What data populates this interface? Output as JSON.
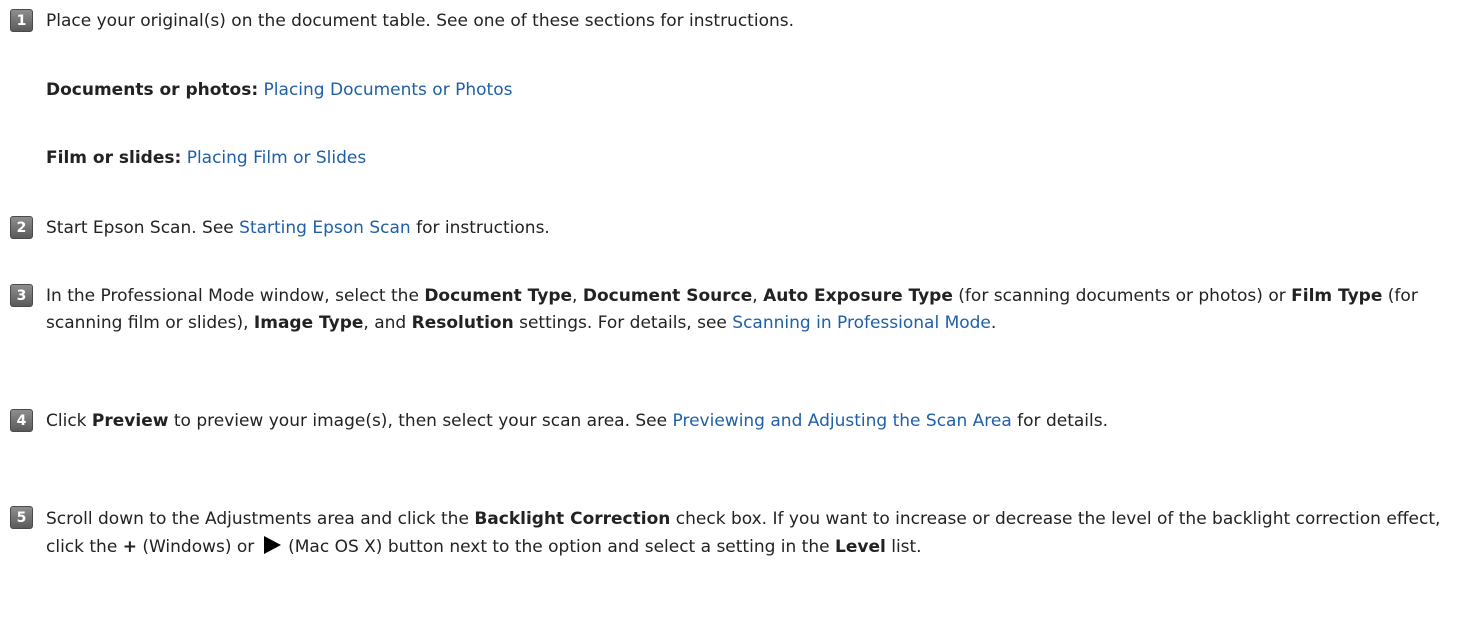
{
  "steps": [
    {
      "number": "1",
      "text_1": "Place your original(s) on the document table. See one of these sections for instructions."
    },
    {
      "number": "2",
      "text_1": "Start Epson Scan. See ",
      "link_1": "Starting Epson Scan",
      "text_2": " for instructions."
    },
    {
      "number": "3",
      "text_1": "In the Professional Mode window, select the ",
      "bold_1": "Document Type",
      "text_2": ", ",
      "bold_2": "Document Source",
      "text_3": ", ",
      "bold_3": "Auto Exposure Type",
      "text_4": " (for scanning documents or photos) or ",
      "bold_4": "Film Type",
      "text_5": " (for scanning film or slides), ",
      "bold_5": "Image Type",
      "text_6": ", and ",
      "bold_6": "Resolution",
      "text_7": " settings. For details, see ",
      "link_1": "Scanning in Professional Mode",
      "text_8": "."
    },
    {
      "number": "4",
      "text_1": "Click ",
      "bold_1": "Preview",
      "text_2": " to preview your image(s), then select your scan area. See ",
      "link_1": "Previewing and Adjusting the Scan Area",
      "text_3": " for details."
    },
    {
      "number": "5",
      "text_1": "Scroll down to the Adjustments area and click the ",
      "bold_1": "Backlight Correction",
      "text_2": " check box. If you want to increase or decrease the level of the backlight correction effect, click the ",
      "bold_2": "+",
      "text_3": " (Windows) or ",
      "icon": "play-triangle-icon",
      "text_4": " (Mac OS X) button next to the option and select a setting in the ",
      "bold_3": "Level",
      "text_5": " list."
    }
  ],
  "sections": [
    {
      "label": "Documents or photos:",
      "link": "Placing Documents or Photos"
    },
    {
      "label": "Film or slides:",
      "link": "Placing Film or Slides"
    }
  ],
  "colors": {
    "link": "#1f5fa8",
    "text": "#222222",
    "badge": "#6e6e6e"
  }
}
